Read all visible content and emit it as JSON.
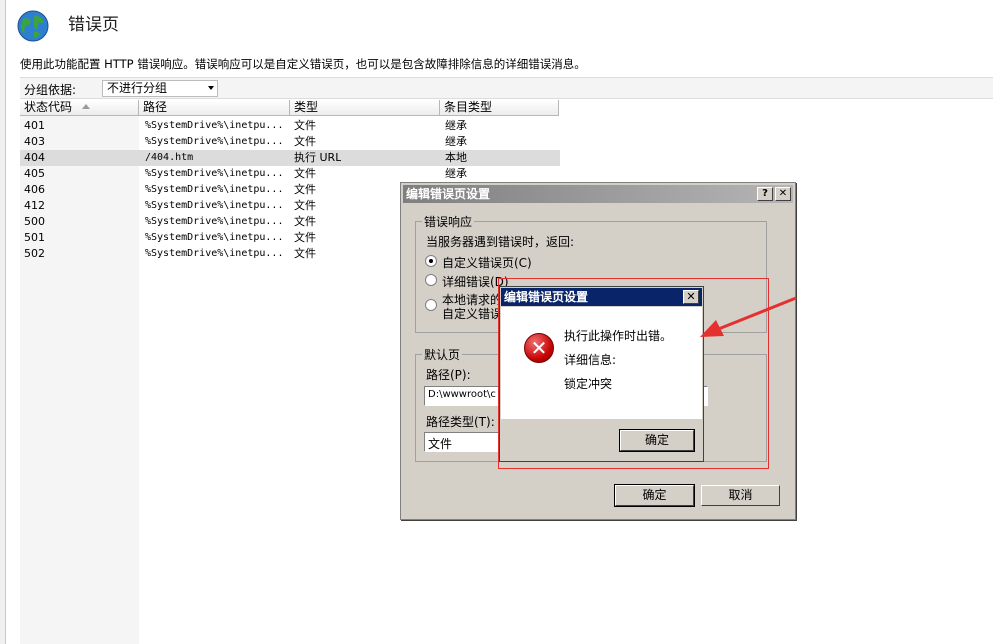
{
  "header": {
    "title": "错误页",
    "description": "使用此功能配置 HTTP 错误响应。错误响应可以是自定义错误页，也可以是包含故障排除信息的详细错误消息。"
  },
  "grouping": {
    "label": "分组依据:",
    "value": "不进行分组"
  },
  "columns": [
    "状态代码",
    "路径",
    "类型",
    "条目类型"
  ],
  "rows": [
    {
      "code": "401",
      "path": "%SystemDrive%\\inetpu...",
      "type": "文件",
      "entry": "继承"
    },
    {
      "code": "403",
      "path": "%SystemDrive%\\inetpu...",
      "type": "文件",
      "entry": "继承"
    },
    {
      "code": "404",
      "path": "/404.htm",
      "type": "执行 URL",
      "entry": "本地"
    },
    {
      "code": "405",
      "path": "%SystemDrive%\\inetpu...",
      "type": "文件",
      "entry": "继承"
    },
    {
      "code": "406",
      "path": "%SystemDrive%\\inetpu...",
      "type": "文件",
      "entry": "继承"
    },
    {
      "code": "412",
      "path": "%SystemDrive%\\inetpu...",
      "type": "文件",
      "entry": "继承"
    },
    {
      "code": "500",
      "path": "%SystemDrive%\\inetpu...",
      "type": "文件",
      "entry": "继承"
    },
    {
      "code": "501",
      "path": "%SystemDrive%\\inetpu...",
      "type": "文件",
      "entry": "继承"
    },
    {
      "code": "502",
      "path": "%SystemDrive%\\inetpu...",
      "type": "文件",
      "entry": "继承"
    }
  ],
  "edit_dialog": {
    "title": "编辑错误页设置",
    "help_button": "?",
    "close_button": "✕",
    "response_group": "错误响应",
    "response_prompt": "当服务器遇到错误时，返回:",
    "option_custom": "自定义错误页(C)",
    "option_detailed": "详细错误(D)",
    "option_local_line1": "本地请求的",
    "option_local_line2": "自定义错误",
    "default_group": "默认页",
    "path_label": "路径(P):",
    "path_value": "D:\\wwwroot\\c",
    "path_type_label": "路径类型(T):",
    "path_type_value": "文件",
    "ok": "确定",
    "cancel": "取消"
  },
  "error_dialog": {
    "title": "编辑错误页设置",
    "close_button": "✕",
    "message": "执行此操作时出错。",
    "details_label": "详细信息:",
    "details_value": "锁定冲突",
    "ok": "确定",
    "icon": "error-x-icon"
  },
  "colors": {
    "annotation_red": "#e53030",
    "error_title_bar": "#0a246a",
    "dialog_gray": "#d4d0c8"
  }
}
